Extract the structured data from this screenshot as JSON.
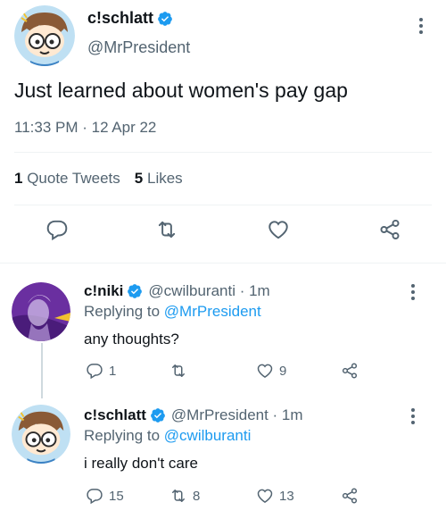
{
  "main_tweet": {
    "display_name": "c!schlatt",
    "handle": "@MrPresident",
    "text": "Just learned about women's pay gap",
    "timestamp": "11:33 PM · 12 Apr 22",
    "quote_tweets_count": "1",
    "quote_tweets_label": "Quote Tweets",
    "likes_count": "5",
    "likes_label": "Likes"
  },
  "replies": [
    {
      "display_name": "c!niki",
      "handle_time": "@cwilburanti · 1m",
      "replying_prefix": "Replying to",
      "replying_to": "@MrPresident",
      "text": "any thoughts?",
      "reply_count": "1",
      "retweet_count": "",
      "like_count": "9"
    },
    {
      "display_name": "c!schlatt",
      "handle_time": "@MrPresident · 1m",
      "replying_prefix": "Replying to",
      "replying_to": "@cwilburanti",
      "text": "i really don't care",
      "reply_count": "15",
      "retweet_count": "8",
      "like_count": "13"
    }
  ],
  "icons": [
    "more-icon",
    "verified-badge-icon",
    "reply-icon",
    "retweet-icon",
    "like-icon",
    "share-icon"
  ],
  "colors": {
    "accent": "#1d9bf0",
    "secondary_text": "#536471",
    "divider": "#eff3f4"
  }
}
